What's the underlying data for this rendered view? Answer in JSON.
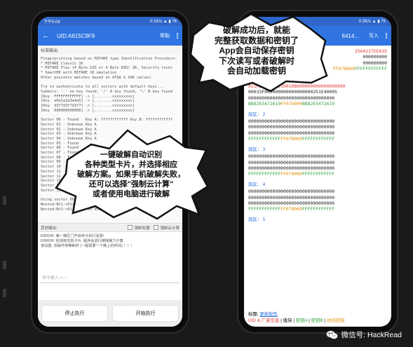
{
  "left_phone": {
    "status_time": "下午5:08",
    "status_right": "0.1K/s",
    "battery": "76",
    "title": "UID:A615C9F9",
    "help_label": "帮助",
    "std_out_label": "标准输出:",
    "std_out_lines": [
      "Fingerprinting based on MIFARE type Identification Procedure:",
      "* MIFARE Classic 1K",
      "* MIFARE Plus (4 Byte UID or 4 Byte RID) 2K, Security level",
      "* SmartMX with MIFARE 1K emulation",
      "Other possible matches based on ATQA & SAK values:",
      "",
      "Try to authenticate to all sectors with default keys...",
      "Symbols: '.' no key found, '/' A key found, '\\' B key found",
      "[Key  FFFFFFFFFFFF] -> [........xxxxxxxxx]",
      "[Key  a0a1a2a3a4a5] -> [........xxxxxxxxx]",
      "[Key  d3f7d3f7d3f7] -> [........xxxxxxxxx]",
      "[Key  000000000000] -> [........xxxxxxxxx]",
      "",
      "Sector 00 - Found   Key A: ffffffffffff Key B: ffffffffffff",
      "Sector 01 - Unknown Key A",
      "Sector 02 - Unknown Key A",
      "Sector 03 - Unknown Key A",
      "Sector 04 - Unknown Key A",
      "Sector 05 - Found",
      "Sector 06 - Found",
      "Sector 07 - Found",
      "Sector 08 - Found",
      "Sector 09 - Found",
      "Sector 10 - Found",
      "Sector 11 - Found",
      "Sector 12 - Found",
      "Sector 13 - Found",
      "Sector 14 - Found",
      "Sector 15 - Found",
      "",
      "Using sector 00 as an exploit sector",
      "Nested:Nt1->01200145 vs  ...",
      "Nested:Nt1->01200145 xx Nt2->01200145"
    ],
    "other_out_label": "其他输出:",
    "checkbox_force_label": "强制兆爆",
    "checkbox_cloud_label": "强制云计算",
    "err_lines": [
      "ERROR: 第一扇区门开启命令执行失败!",
      "ERROR: 检测到无损卡片, 程序会进行链接暴力计算",
      "该设置, 该操作将等耗时 (一般需要一个晚上的时间) ！！！"
    ],
    "cmd_placeholder": "命令输入 <---",
    "stop_label": "停止执行",
    "start_label": "开始执行"
  },
  "right_phone": {
    "status_right": "0.3K/s",
    "battery": "75",
    "title_partial": "6414...",
    "write_label": "写入",
    "top_partial_lines": [
      {
        "pre": "",
        "red": "25A4227EEA1D"
      },
      {
        "pre": "",
        "red": "000000000"
      },
      {
        "pre": "",
        "red": "000000000"
      },
      {
        "pre": "FF078069",
        "red": "FFFFFFFFFFFF"
      }
    ],
    "sectors": [
      {
        "label": "扇区: 1",
        "lines": [
          {
            "text": "021FDE10015C10010B000000000000008000"
          },
          {
            "text": "00033F000000000000000000251E40005"
          },
          {
            "text": "00000000000000000000000000000000"
          },
          {
            "keyA": "BB82E5472619",
            "acc": "FF078000",
            "keyB": "BB82E5472619"
          }
        ]
      },
      {
        "label": "扇区: 2",
        "lines": [
          {
            "text": "00000000000000000000000000000000"
          },
          {
            "text": "00000000000000000000000000000000"
          },
          {
            "text": "00000000000000000000000000000000"
          },
          {
            "keyA": "FFFFFFFFFFFF",
            "acc": "FF078069",
            "keyB": "FFFFFFFFFFFF"
          }
        ]
      },
      {
        "label": "扇区: 3",
        "lines": [
          {
            "text": "00000000000000000000000000000000"
          },
          {
            "text": "00000000000000000000000000000000"
          },
          {
            "text": "00000000000000000000000000000000"
          },
          {
            "keyA": "FFFFFFFFFFFF",
            "acc": "FF078069",
            "keyB": "FFFFFFFFFFFF"
          }
        ]
      },
      {
        "label": "扇区: 4",
        "lines": [
          {
            "text": "00000000000000000000000000000000"
          },
          {
            "text": "00000000000000000000000000000000"
          },
          {
            "text": "00000000000000000000000000000000"
          },
          {
            "keyA": "FFFFFFFFFFFF",
            "acc": "FF078069",
            "keyB": "FFFFFFFFFFFF"
          }
        ]
      },
      {
        "label": "扇区: 5",
        "lines": []
      }
    ],
    "legend_label": "标题:",
    "legend_change": "更新配色",
    "legend_uid": "UID & 厂家信息",
    "legend_value": "值块",
    "legend_keya": "密钥A",
    "legend_keyb": "密钥B",
    "legend_access": "访问控制",
    "sep": "|"
  },
  "bubble_top": {
    "lines": [
      "破解成功后，就能",
      "完整获取数据和密钥了",
      "App会自动保存密钥",
      "下次读写或者破解时",
      "会自动加载密钥"
    ]
  },
  "bubble_mid": {
    "lines": [
      "一键破解自动识别",
      "各种类型卡片，并选择相应",
      "破解方案。如果手机破解失败，",
      "还可以选择\"强制云计算\"",
      "或者使用电脑进行破解"
    ]
  },
  "watermark": {
    "text": "微信号: HackRead"
  },
  "colors": {
    "appbar": "#2f74e0",
    "statusbar": "#2f66c9",
    "key_a": "#2e9e3e",
    "key_b": "#2e9e3e",
    "access": "#e08a00",
    "uid": "#e53935"
  }
}
